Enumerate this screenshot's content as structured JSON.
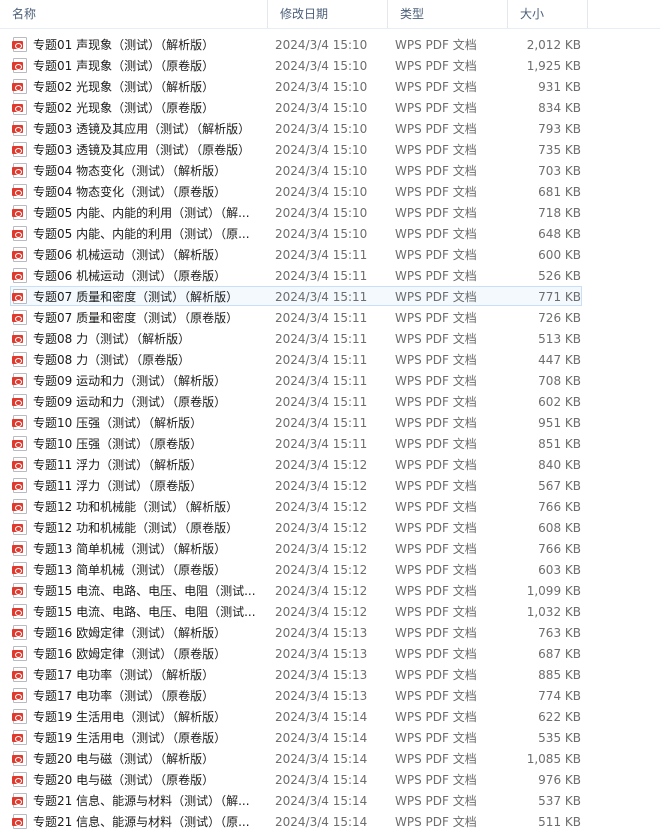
{
  "columns": {
    "name": "名称",
    "date": "修改日期",
    "type": "类型",
    "size": "大小",
    "sort_indicator": "^"
  },
  "icon": "pdf-file-icon",
  "selected_row": 12,
  "files": [
    {
      "name": "专题01  声现象（测试）（解析版）",
      "date": "2024/3/4 15:10",
      "type": "WPS PDF 文档",
      "size": "2,012 KB"
    },
    {
      "name": "专题01  声现象（测试）（原卷版）",
      "date": "2024/3/4 15:10",
      "type": "WPS PDF 文档",
      "size": "1,925 KB"
    },
    {
      "name": "专题02  光现象（测试）（解析版）",
      "date": "2024/3/4 15:10",
      "type": "WPS PDF 文档",
      "size": "931 KB"
    },
    {
      "name": "专题02  光现象（测试）（原卷版）",
      "date": "2024/3/4 15:10",
      "type": "WPS PDF 文档",
      "size": "834 KB"
    },
    {
      "name": "专题03  透镜及其应用（测试）（解析版）",
      "date": "2024/3/4 15:10",
      "type": "WPS PDF 文档",
      "size": "793 KB"
    },
    {
      "name": "专题03  透镜及其应用（测试）（原卷版）",
      "date": "2024/3/4 15:10",
      "type": "WPS PDF 文档",
      "size": "735 KB"
    },
    {
      "name": "专题04  物态变化（测试）（解析版）",
      "date": "2024/3/4 15:10",
      "type": "WPS PDF 文档",
      "size": "703 KB"
    },
    {
      "name": "专题04  物态变化（测试）（原卷版）",
      "date": "2024/3/4 15:10",
      "type": "WPS PDF 文档",
      "size": "681 KB"
    },
    {
      "name": "专题05  内能、内能的利用（测试）（解...",
      "date": "2024/3/4 15:10",
      "type": "WPS PDF 文档",
      "size": "718 KB"
    },
    {
      "name": "专题05  内能、内能的利用（测试）（原...",
      "date": "2024/3/4 15:10",
      "type": "WPS PDF 文档",
      "size": "648 KB"
    },
    {
      "name": "专题06  机械运动（测试）（解析版）",
      "date": "2024/3/4 15:11",
      "type": "WPS PDF 文档",
      "size": "600 KB"
    },
    {
      "name": "专题06  机械运动（测试）（原卷版）",
      "date": "2024/3/4 15:11",
      "type": "WPS PDF 文档",
      "size": "526 KB"
    },
    {
      "name": "专题07  质量和密度（测试）（解析版）",
      "date": "2024/3/4 15:11",
      "type": "WPS PDF 文档",
      "size": "771 KB"
    },
    {
      "name": "专题07  质量和密度（测试）（原卷版）",
      "date": "2024/3/4 15:11",
      "type": "WPS PDF 文档",
      "size": "726 KB"
    },
    {
      "name": "专题08  力（测试）（解析版）",
      "date": "2024/3/4 15:11",
      "type": "WPS PDF 文档",
      "size": "513 KB"
    },
    {
      "name": "专题08  力（测试）（原卷版）",
      "date": "2024/3/4 15:11",
      "type": "WPS PDF 文档",
      "size": "447 KB"
    },
    {
      "name": "专题09  运动和力（测试）（解析版）",
      "date": "2024/3/4 15:11",
      "type": "WPS PDF 文档",
      "size": "708 KB"
    },
    {
      "name": "专题09  运动和力（测试）（原卷版）",
      "date": "2024/3/4 15:11",
      "type": "WPS PDF 文档",
      "size": "602 KB"
    },
    {
      "name": "专题10  压强（测试）（解析版）",
      "date": "2024/3/4 15:11",
      "type": "WPS PDF 文档",
      "size": "951 KB"
    },
    {
      "name": "专题10  压强（测试）（原卷版）",
      "date": "2024/3/4 15:11",
      "type": "WPS PDF 文档",
      "size": "851 KB"
    },
    {
      "name": "专题11  浮力（测试）（解析版）",
      "date": "2024/3/4 15:12",
      "type": "WPS PDF 文档",
      "size": "840 KB"
    },
    {
      "name": "专题11  浮力（测试）（原卷版）",
      "date": "2024/3/4 15:12",
      "type": "WPS PDF 文档",
      "size": "567 KB"
    },
    {
      "name": "专题12  功和机械能（测试）（解析版）",
      "date": "2024/3/4 15:12",
      "type": "WPS PDF 文档",
      "size": "766 KB"
    },
    {
      "name": "专题12  功和机械能（测试）（原卷版）",
      "date": "2024/3/4 15:12",
      "type": "WPS PDF 文档",
      "size": "608 KB"
    },
    {
      "name": "专题13  简单机械（测试）（解析版）",
      "date": "2024/3/4 15:12",
      "type": "WPS PDF 文档",
      "size": "766 KB"
    },
    {
      "name": "专题13  简单机械（测试）（原卷版）",
      "date": "2024/3/4 15:12",
      "type": "WPS PDF 文档",
      "size": "603 KB"
    },
    {
      "name": "专题15  电流、电路、电压、电阻（测试...",
      "date": "2024/3/4 15:12",
      "type": "WPS PDF 文档",
      "size": "1,099 KB"
    },
    {
      "name": "专题15  电流、电路、电压、电阻（测试...",
      "date": "2024/3/4 15:12",
      "type": "WPS PDF 文档",
      "size": "1,032 KB"
    },
    {
      "name": "专题16  欧姆定律（测试）（解析版）",
      "date": "2024/3/4 15:13",
      "type": "WPS PDF 文档",
      "size": "763 KB"
    },
    {
      "name": "专题16  欧姆定律（测试）（原卷版）",
      "date": "2024/3/4 15:13",
      "type": "WPS PDF 文档",
      "size": "687 KB"
    },
    {
      "name": "专题17  电功率（测试）（解析版）",
      "date": "2024/3/4 15:13",
      "type": "WPS PDF 文档",
      "size": "885 KB"
    },
    {
      "name": "专题17  电功率（测试）（原卷版）",
      "date": "2024/3/4 15:13",
      "type": "WPS PDF 文档",
      "size": "774 KB"
    },
    {
      "name": "专题19  生活用电（测试）（解析版）",
      "date": "2024/3/4 15:14",
      "type": "WPS PDF 文档",
      "size": "622 KB"
    },
    {
      "name": "专题19  生活用电（测试）（原卷版）",
      "date": "2024/3/4 15:14",
      "type": "WPS PDF 文档",
      "size": "535 KB"
    },
    {
      "name": "专题20  电与磁（测试）（解析版）",
      "date": "2024/3/4 15:14",
      "type": "WPS PDF 文档",
      "size": "1,085 KB"
    },
    {
      "name": "专题20  电与磁（测试）（原卷版）",
      "date": "2024/3/4 15:14",
      "type": "WPS PDF 文档",
      "size": "976 KB"
    },
    {
      "name": "专题21  信息、能源与材料（测试）（解...",
      "date": "2024/3/4 15:14",
      "type": "WPS PDF 文档",
      "size": "537 KB"
    },
    {
      "name": "专题21  信息、能源与材料（测试）（原...",
      "date": "2024/3/4 15:14",
      "type": "WPS PDF 文档",
      "size": "511 KB"
    }
  ]
}
